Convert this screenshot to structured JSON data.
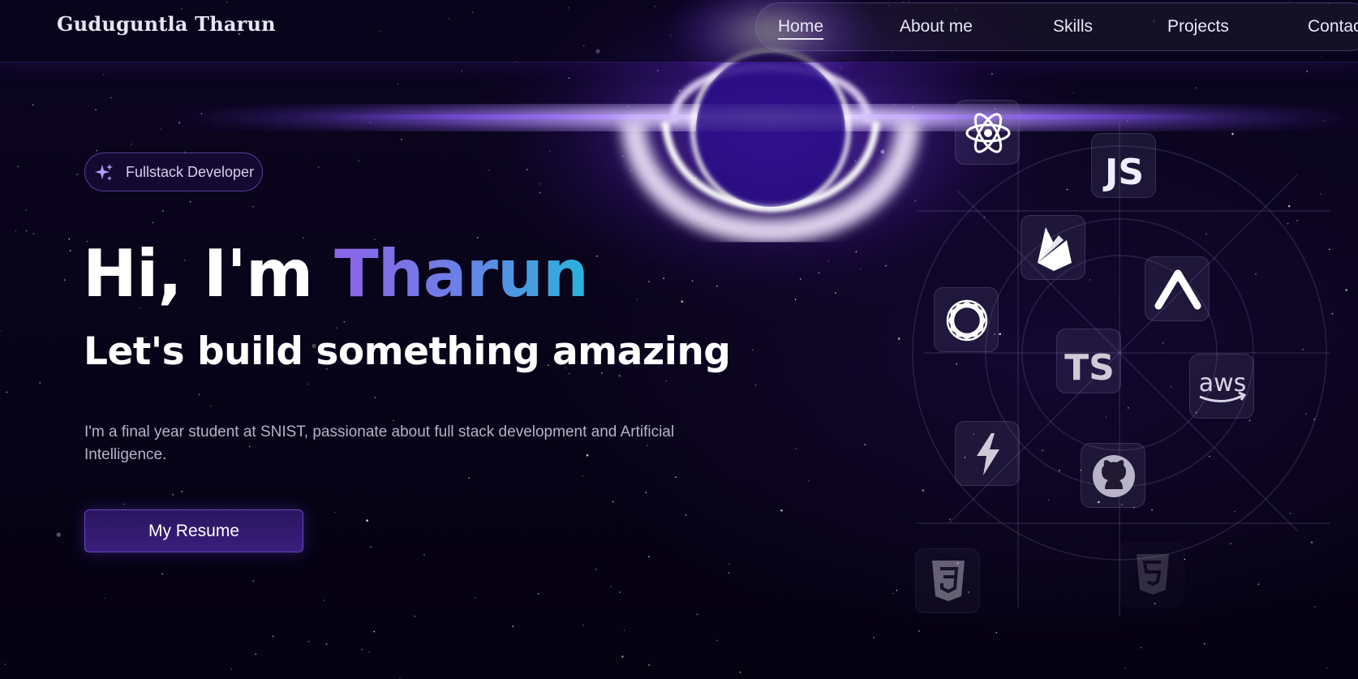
{
  "header": {
    "logo": "Guduguntla Tharun",
    "nav": [
      {
        "label": "Home",
        "active": true
      },
      {
        "label": "About me",
        "active": false
      },
      {
        "label": "Skills",
        "active": false
      },
      {
        "label": "Projects",
        "active": false
      },
      {
        "label": "Contact",
        "active": false
      }
    ]
  },
  "hero": {
    "badge": "Fullstack Developer",
    "greeting": "Hi, I'm ",
    "name": "Tharun",
    "subtitle": "Let's build something amazing",
    "description": "I'm a final year student at SNIST, passionate about full stack development and Artificial Intelligence.",
    "resume_button": "My Resume"
  },
  "skills": {
    "js_label": "JS",
    "ts_label": "TS",
    "aws_label": "aws",
    "icons": [
      "react-icon",
      "javascript-icon",
      "firebase-icon",
      "vercel-icon",
      "openai-icon",
      "typescript-icon",
      "aws-icon",
      "vite-icon",
      "github-icon",
      "css3-icon",
      "html5-icon"
    ]
  },
  "colors": {
    "background": "#060214",
    "accent_purple": "#8c63e8",
    "accent_cyan": "#27b4dc",
    "button": "#2a1560"
  }
}
